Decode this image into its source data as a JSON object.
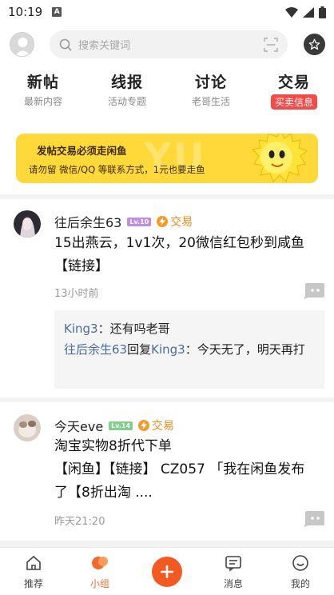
{
  "status_bar": {
    "time": "10:19",
    "sim_label": "A"
  },
  "header": {
    "search_placeholder": "搜索关键词"
  },
  "tabs": [
    {
      "title": "新帖",
      "subtitle": "最新内容"
    },
    {
      "title": "线报",
      "subtitle": "活动专题"
    },
    {
      "title": "讨论",
      "subtitle": "老哥生活"
    },
    {
      "title": "交易",
      "subtitle": "买卖信息",
      "active": true
    }
  ],
  "banner": {
    "line1": "发帖交易必须走闲鱼",
    "line2": "请勿留 微信/QQ 等联系方式，1元也要走鱼",
    "color": "#ffd83a"
  },
  "posts": [
    {
      "username": "往后余生63",
      "level": "Lv.10",
      "tag": "交易",
      "content": "15出燕云，1v1次，20微信红包秒到咸鱼【链接】",
      "time": "13小时前",
      "replies": [
        {
          "user": "King3",
          "sep": "：",
          "text": "还有吗老哥"
        },
        {
          "user": "往后余生63",
          "verb": "回复",
          "target": "King3",
          "sep": "：",
          "text": "今天无了，明天再打"
        }
      ]
    },
    {
      "username": "今天eve",
      "level": "Lv.14",
      "tag": "交易",
      "content": "淘宝实物8折代下单\n【闲鱼】【链接】 CZ057 「我在闲鱼发布了【8折出淘 ....",
      "time": "昨天21:20"
    }
  ],
  "bottom_nav": [
    {
      "label": "推荐",
      "icon": "home-icon"
    },
    {
      "label": "小组",
      "icon": "group-icon",
      "active": true
    },
    {
      "label": "",
      "icon": "plus-icon"
    },
    {
      "label": "消息",
      "icon": "message-icon"
    },
    {
      "label": "我的",
      "icon": "profile-icon"
    }
  ],
  "colors": {
    "accent": "#f25a22",
    "trade": "#f08a1c",
    "tab_active_badge": "#f44b48",
    "link": "#4a6aa0"
  }
}
